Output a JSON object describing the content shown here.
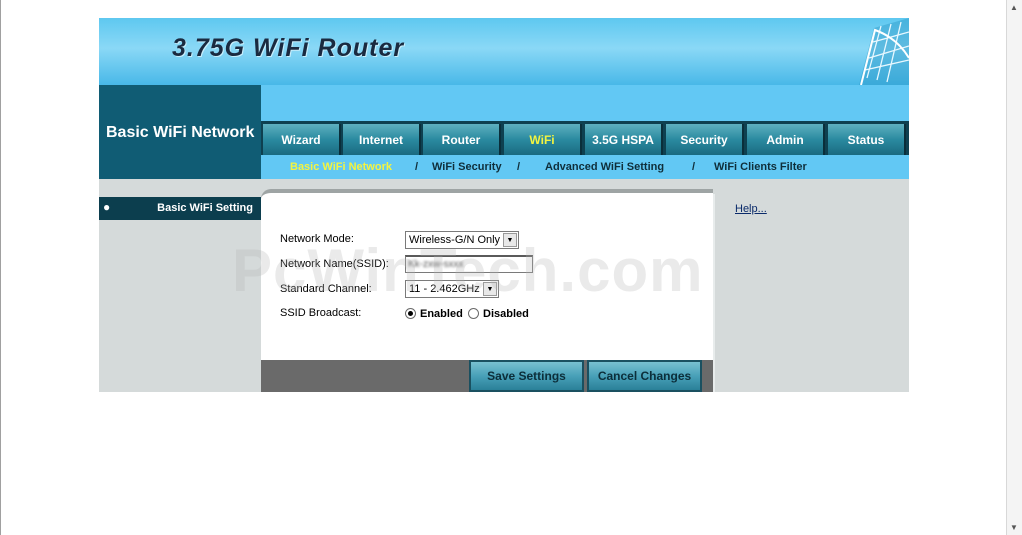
{
  "banner": {
    "title": "3.75G WiFi Router"
  },
  "section_title": "Basic WiFi Network",
  "tabs": [
    {
      "label": "Wizard",
      "active": false
    },
    {
      "label": "Internet",
      "active": false
    },
    {
      "label": "Router",
      "active": false
    },
    {
      "label": "WiFi",
      "active": true
    },
    {
      "label": "3.5G HSPA",
      "active": false
    },
    {
      "label": "Security",
      "active": false
    },
    {
      "label": "Admin",
      "active": false
    },
    {
      "label": "Status",
      "active": false
    }
  ],
  "subnav": {
    "items": [
      {
        "label": "Basic WiFi Network",
        "active": true
      },
      {
        "label": "WiFi Security",
        "active": false
      },
      {
        "label": "Advanced WiFi Setting",
        "active": false
      },
      {
        "label": "WiFi Clients Filter",
        "active": false
      }
    ],
    "separator": "/"
  },
  "left_menu": {
    "bullet": "●",
    "label": "Basic WiFi Setting"
  },
  "form": {
    "network_mode": {
      "label": "Network Mode:",
      "value": "Wireless-G/N Only"
    },
    "ssid": {
      "label": "Network Name(SSID):",
      "value": "Kk-zxw-sxxx"
    },
    "channel": {
      "label": "Standard Channel:",
      "value": "11 - 2.462GHz"
    },
    "broadcast": {
      "label": "SSID Broadcast:",
      "enabled_label": "Enabled",
      "disabled_label": "Disabled",
      "selected": "Enabled"
    }
  },
  "buttons": {
    "save": "Save Settings",
    "cancel": "Cancel Changes"
  },
  "help": {
    "label": "Help..."
  },
  "watermark": "PcWinTech.com",
  "colors": {
    "active_text": "#f4f440",
    "section_bg": "#105c74",
    "nav_bg": "#62c8f4"
  }
}
